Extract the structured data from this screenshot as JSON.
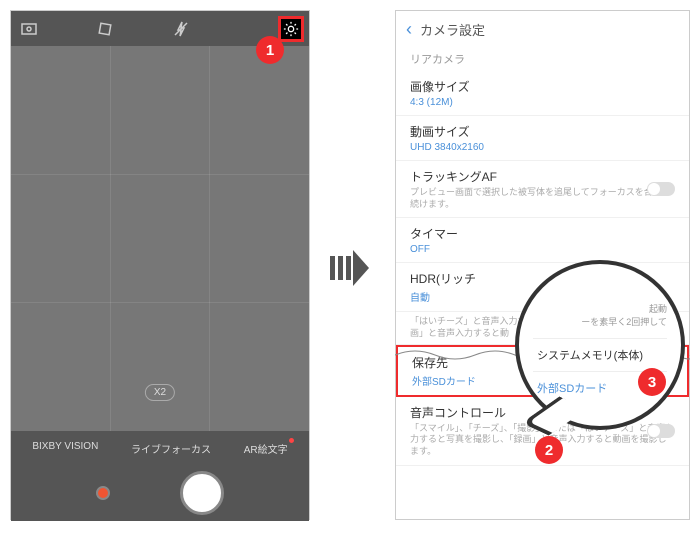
{
  "camera": {
    "zoom_badge": "X2",
    "modes": {
      "bixby": "BIXBY VISION",
      "live_focus": "ライブフォーカス",
      "ar_emoji": "AR絵文字"
    }
  },
  "settings": {
    "header_title": "カメラ設定",
    "section_rear": "リアカメラ",
    "image_size": {
      "label": "画像サイズ",
      "value": "4:3 (12M)"
    },
    "video_size": {
      "label": "動画サイズ",
      "value": "UHD 3840x2160"
    },
    "tracking_af": {
      "label": "トラッキングAF",
      "desc": "プレビュー画面で選択した被写体を追尾してフォーカスを合わせ続けます。"
    },
    "timer": {
      "label": "タイマー",
      "value": "OFF"
    },
    "hdr": {
      "label": "HDR(リッチ",
      "value": "自動"
    },
    "quick_launch_hint": "ーを素早く2回押して",
    "voice_hint": "「はいチーズ」と音声入力すると\n画」と音声入力すると動",
    "storage": {
      "label": "保存先",
      "value": "外部SDカード"
    },
    "voice_control": {
      "label": "音声コントロール",
      "desc": "「スマイル」、「チーズ」、「撮影」、または「はいチーズ」と音声入力すると写真を撮影し、「録画」と音声入力すると動画を撮影します。"
    }
  },
  "callout": {
    "hint": "起動",
    "option_internal": "システムメモリ(本体)",
    "option_sd": "外部SDカード"
  },
  "steps": {
    "s1": "1",
    "s2": "2",
    "s3": "3"
  }
}
